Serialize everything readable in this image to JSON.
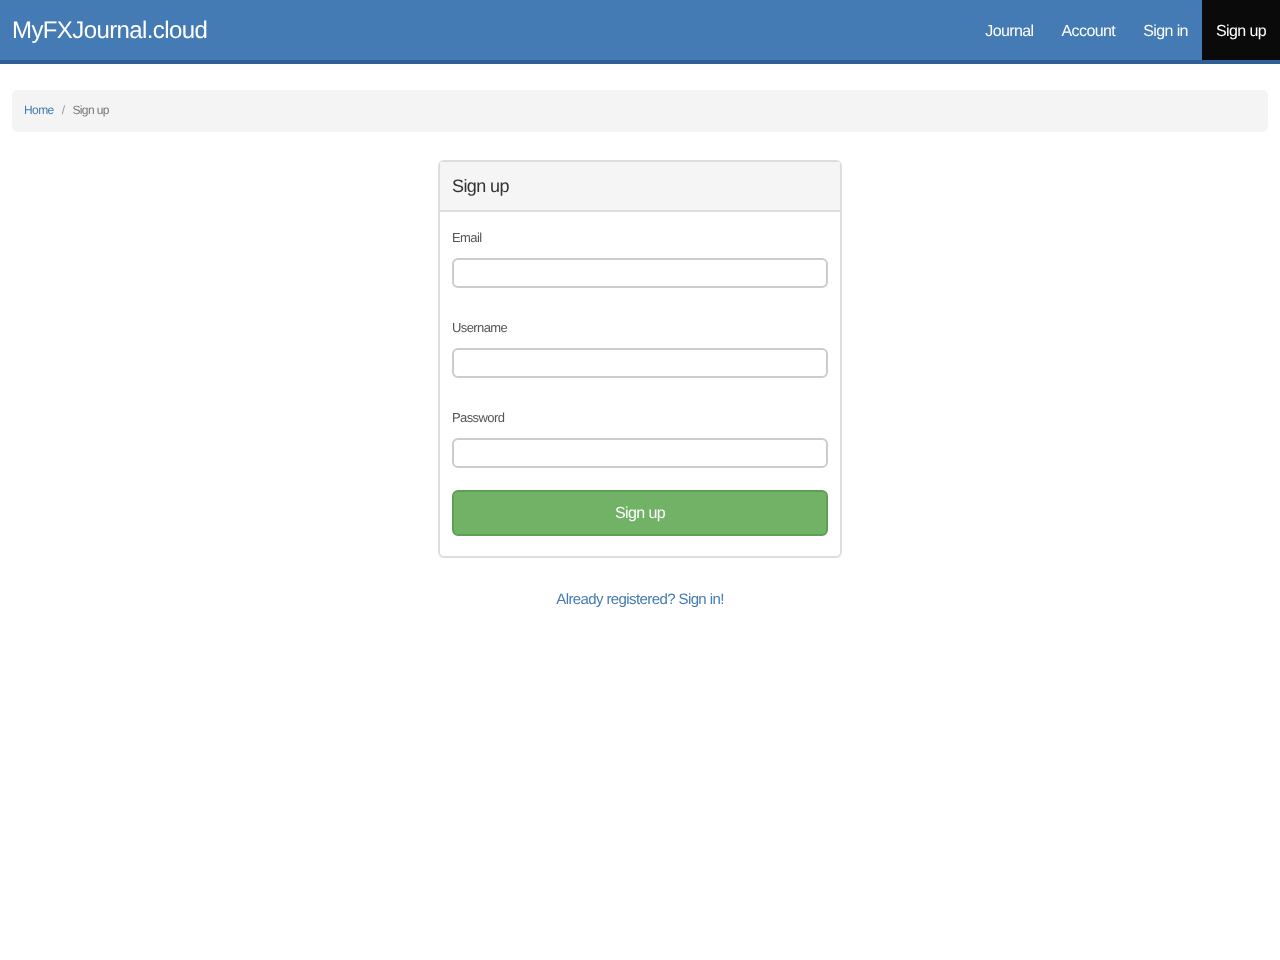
{
  "navbar": {
    "brand": "MyFXJournal.cloud",
    "items": [
      {
        "label": "Journal",
        "selected": false
      },
      {
        "label": "Account",
        "selected": false
      },
      {
        "label": "Sign in",
        "selected": false
      },
      {
        "label": "Sign up",
        "selected": true
      }
    ]
  },
  "breadcrumb_separator": "/",
  "breadcrumb": [
    {
      "label": "Home",
      "selected": false
    },
    {
      "label": "Sign up",
      "selected": true
    }
  ],
  "panel": {
    "title": "Sign up",
    "fields": [
      {
        "label": "Email"
      },
      {
        "label": "Username"
      },
      {
        "label": "Password"
      }
    ],
    "submit": "Sign up"
  },
  "footer_link": "Already registered? Sign in!"
}
